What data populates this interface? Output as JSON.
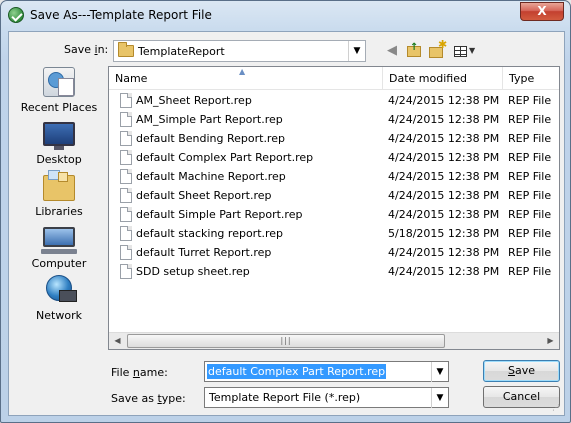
{
  "window": {
    "title": "Save As---Template Report File",
    "close_label": "X"
  },
  "location": {
    "label_prefix": "Save ",
    "label_accel": "i",
    "label_suffix": "n:",
    "value": "TemplateReport"
  },
  "places": [
    {
      "label": "Recent Places",
      "icon": "recent-places-icon"
    },
    {
      "label": "Desktop",
      "icon": "desktop-icon"
    },
    {
      "label": "Libraries",
      "icon": "libraries-icon"
    },
    {
      "label": "Computer",
      "icon": "computer-icon"
    },
    {
      "label": "Network",
      "icon": "network-icon"
    }
  ],
  "columns": {
    "name": "Name",
    "date": "Date modified",
    "type": "Type"
  },
  "files": [
    {
      "name": "AM_Sheet Report.rep",
      "date": "4/24/2015 12:38 PM",
      "type": "REP File"
    },
    {
      "name": "AM_Simple Part Report.rep",
      "date": "4/24/2015 12:38 PM",
      "type": "REP File"
    },
    {
      "name": "default Bending Report.rep",
      "date": "4/24/2015 12:38 PM",
      "type": "REP File"
    },
    {
      "name": "default Complex Part Report.rep",
      "date": "4/24/2015 12:38 PM",
      "type": "REP File"
    },
    {
      "name": "default Machine Report.rep",
      "date": "4/24/2015 12:38 PM",
      "type": "REP File"
    },
    {
      "name": "default Sheet Report.rep",
      "date": "4/24/2015 12:38 PM",
      "type": "REP File"
    },
    {
      "name": "default Simple Part Report.rep",
      "date": "4/24/2015 12:38 PM",
      "type": "REP File"
    },
    {
      "name": "default stacking report.rep",
      "date": "5/18/2015 12:38 PM",
      "type": "REP File"
    },
    {
      "name": "default Turret Report.rep",
      "date": "4/24/2015 12:38 PM",
      "type": "REP File"
    },
    {
      "name": "SDD setup sheet.rep",
      "date": "4/24/2015 12:38 PM",
      "type": "REP File"
    }
  ],
  "form": {
    "filename_label_pre": "File ",
    "filename_label_accel": "n",
    "filename_label_post": "ame:",
    "filename_value": "default Complex Part Report.rep",
    "filetype_label_pre": "Save as ",
    "filetype_label_accel": "t",
    "filetype_label_post": "ype:",
    "filetype_value": "Template Report File (*.rep)"
  },
  "buttons": {
    "save_accel": "S",
    "save_rest": "ave",
    "cancel": "Cancel"
  },
  "colors": {
    "selection": "#3399ff",
    "title_gradient": "#c9dbee",
    "close_button": "#c3402f"
  }
}
